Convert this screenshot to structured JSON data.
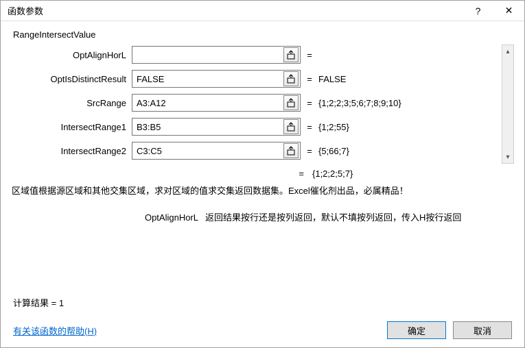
{
  "window": {
    "title": "函数参数"
  },
  "function_name": "RangeIntersectValue",
  "params": [
    {
      "label": "OptAlignHorL",
      "value": "",
      "result": ""
    },
    {
      "label": "OptIsDistinctResult",
      "value": "FALSE",
      "result": "FALSE"
    },
    {
      "label": "SrcRange",
      "value": "A3:A12",
      "result": "{1;2;2;3;5;6;7;8;9;10}"
    },
    {
      "label": "IntersectRange1",
      "value": "B3:B5",
      "result": "{1;2;55}"
    },
    {
      "label": "IntersectRange2",
      "value": "C3:C5",
      "result": "{5;66;7}"
    }
  ],
  "overall_eq": "=",
  "overall_result": "{1;2;2;5;7}",
  "description": "区域值根据源区域和其他交集区域，求对区域的值求交集返回数据集。Excel催化剂出品，必属精品！",
  "arg_help": {
    "name": "OptAlignHorL",
    "text": "返回结果按行还是按列返回，默认不填按列返回，传入H按行返回"
  },
  "calc_label": "计算结果 = ",
  "calc_value": "1",
  "help_link": "有关该函数的帮助(H)",
  "buttons": {
    "ok": "确定",
    "cancel": "取消"
  },
  "eq": "="
}
